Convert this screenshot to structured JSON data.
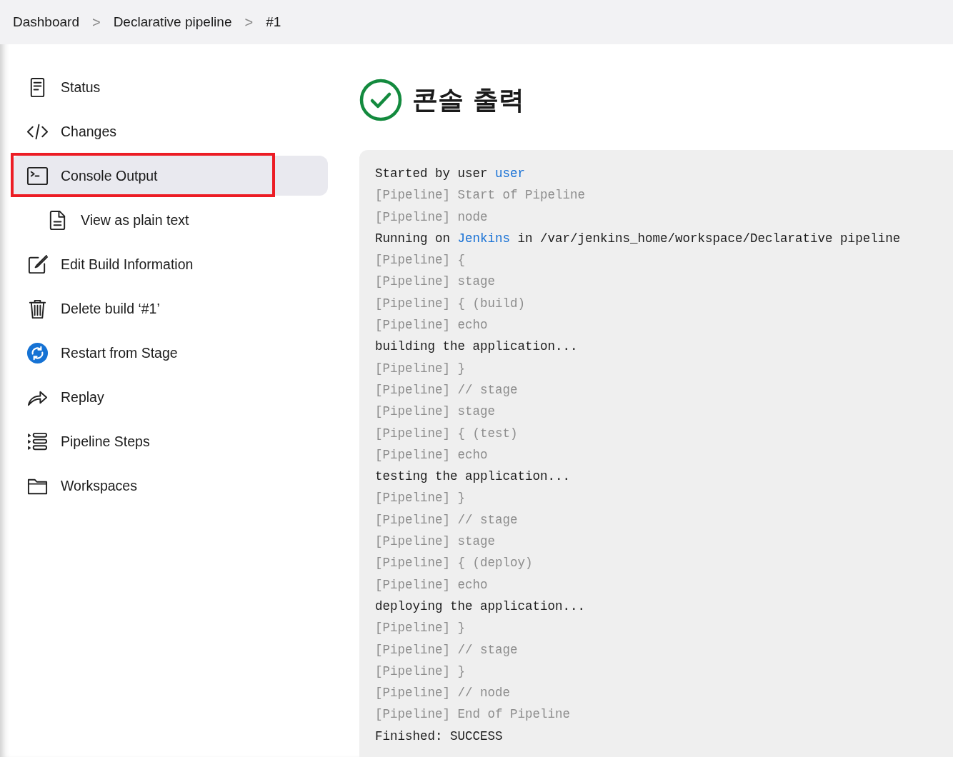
{
  "breadcrumb": [
    {
      "label": "Dashboard"
    },
    {
      "label": "Declarative pipeline"
    },
    {
      "label": "#1"
    }
  ],
  "breadcrumb_separator": ">",
  "sidebar": {
    "items": [
      {
        "label": "Status",
        "selected": false,
        "highlighted": false
      },
      {
        "label": "Changes",
        "selected": false,
        "highlighted": false
      },
      {
        "label": "Console Output",
        "selected": true,
        "highlighted": true,
        "children": [
          {
            "label": "View as plain text",
            "selected": false,
            "highlighted": false
          }
        ]
      },
      {
        "label": "Edit Build Information",
        "selected": false,
        "highlighted": false
      },
      {
        "label": "Delete build ‘#1’",
        "selected": false,
        "highlighted": false
      },
      {
        "label": "Restart from Stage",
        "selected": false,
        "highlighted": false
      },
      {
        "label": "Replay",
        "selected": false,
        "highlighted": false
      },
      {
        "label": "Pipeline Steps",
        "selected": false,
        "highlighted": false
      },
      {
        "label": "Workspaces",
        "selected": false,
        "highlighted": false
      }
    ]
  },
  "main": {
    "title": "콘솔 출력",
    "console": [
      {
        "kind": "plain",
        "text": "Started by user ",
        "link": "user"
      },
      {
        "kind": "pipeline",
        "text": "[Pipeline] Start of Pipeline"
      },
      {
        "kind": "pipeline",
        "text": "[Pipeline] node"
      },
      {
        "kind": "plain",
        "text": "Running on ",
        "link": "Jenkins",
        "after": " in /var/jenkins_home/workspace/Declarative pipeline"
      },
      {
        "kind": "pipeline",
        "text": "[Pipeline] {"
      },
      {
        "kind": "pipeline",
        "text": "[Pipeline] stage"
      },
      {
        "kind": "pipeline",
        "text": "[Pipeline] { (build)"
      },
      {
        "kind": "pipeline",
        "text": "[Pipeline] echo"
      },
      {
        "kind": "plain",
        "text": "building the application..."
      },
      {
        "kind": "pipeline",
        "text": "[Pipeline] }"
      },
      {
        "kind": "pipeline",
        "text": "[Pipeline] // stage"
      },
      {
        "kind": "pipeline",
        "text": "[Pipeline] stage"
      },
      {
        "kind": "pipeline",
        "text": "[Pipeline] { (test)"
      },
      {
        "kind": "pipeline",
        "text": "[Pipeline] echo"
      },
      {
        "kind": "plain",
        "text": "testing the application..."
      },
      {
        "kind": "pipeline",
        "text": "[Pipeline] }"
      },
      {
        "kind": "pipeline",
        "text": "[Pipeline] // stage"
      },
      {
        "kind": "pipeline",
        "text": "[Pipeline] stage"
      },
      {
        "kind": "pipeline",
        "text": "[Pipeline] { (deploy)"
      },
      {
        "kind": "pipeline",
        "text": "[Pipeline] echo"
      },
      {
        "kind": "plain",
        "text": "deploying the application..."
      },
      {
        "kind": "pipeline",
        "text": "[Pipeline] }"
      },
      {
        "kind": "pipeline",
        "text": "[Pipeline] // stage"
      },
      {
        "kind": "pipeline",
        "text": "[Pipeline] }"
      },
      {
        "kind": "pipeline",
        "text": "[Pipeline] // node"
      },
      {
        "kind": "pipeline",
        "text": "[Pipeline] End of Pipeline"
      },
      {
        "kind": "plain",
        "text": "Finished: SUCCESS"
      }
    ]
  }
}
